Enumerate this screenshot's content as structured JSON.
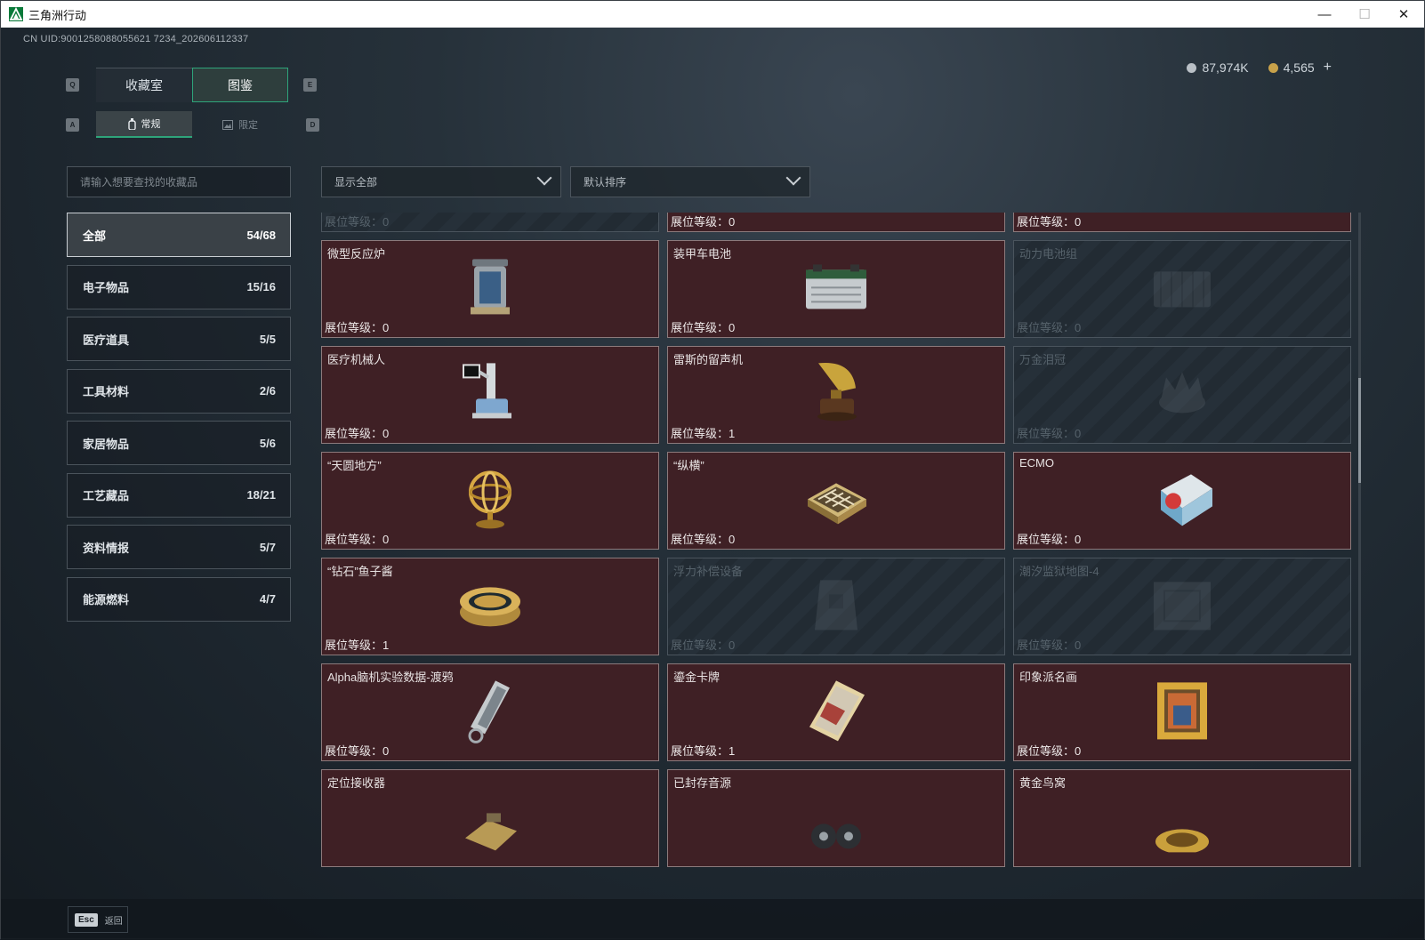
{
  "window": {
    "title": "三角洲行动",
    "minimize": "—",
    "maximize": "☐",
    "close": "✕"
  },
  "uid": "CN UID:9001258088055621 7234_202606112337",
  "currency": [
    {
      "amount": "87,974K",
      "icon": "silver-coin-icon",
      "color": "#b9c0c6"
    },
    {
      "amount": "4,565",
      "icon": "gold-coin-icon",
      "color": "#c8a24a"
    }
  ],
  "plus": "+",
  "key_hints": {
    "q": "Q",
    "e": "E",
    "a": "A",
    "d": "D"
  },
  "tabs": [
    {
      "label": "收藏室",
      "active": false
    },
    {
      "label": "图鉴",
      "active": true
    }
  ],
  "subtabs": [
    {
      "label": "常规",
      "icon": "bottle-icon",
      "active": true
    },
    {
      "label": "限定",
      "icon": "image-icon",
      "active": false
    }
  ],
  "search": {
    "placeholder": "请输入想要查找的收藏品"
  },
  "filters": {
    "show": "显示全部",
    "sort": "默认排序"
  },
  "categories": [
    {
      "label": "全部",
      "count": "54/68",
      "active": true
    },
    {
      "label": "电子物品",
      "count": "15/16"
    },
    {
      "label": "医疗道具",
      "count": "5/5"
    },
    {
      "label": "工具材料",
      "count": "2/6"
    },
    {
      "label": "家居物品",
      "count": "5/6"
    },
    {
      "label": "工艺藏品",
      "count": "18/21"
    },
    {
      "label": "资料情报",
      "count": "5/7"
    },
    {
      "label": "能源燃料",
      "count": "4/7"
    }
  ],
  "level_label": "展位等级：",
  "items": [
    {
      "name": "",
      "level": "0",
      "locked": true,
      "icon": "bag-icon"
    },
    {
      "name": "",
      "level": "0",
      "locked": false,
      "icon": "robot-vacuum-icon"
    },
    {
      "name": "",
      "level": "0",
      "locked": false,
      "icon": "coffee-bag-icon"
    },
    {
      "name": "微型反应炉",
      "level": "0",
      "locked": false,
      "icon": "reactor-icon"
    },
    {
      "name": "装甲车电池",
      "level": "0",
      "locked": false,
      "icon": "battery-icon"
    },
    {
      "name": "动力电池组",
      "level": "0",
      "locked": true,
      "icon": "battery-pack-icon"
    },
    {
      "name": "医疗机械人",
      "level": "0",
      "locked": false,
      "icon": "medical-robot-icon"
    },
    {
      "name": "雷斯的留声机",
      "level": "1",
      "locked": false,
      "icon": "gramophone-icon"
    },
    {
      "name": "万金泪冠",
      "level": "0",
      "locked": true,
      "icon": "crown-icon"
    },
    {
      "name": "“天圆地方”",
      "level": "0",
      "locked": false,
      "icon": "armillary-icon"
    },
    {
      "name": "“纵横”",
      "level": "0",
      "locked": false,
      "icon": "chessboard-icon"
    },
    {
      "name": "ECMO",
      "level": "0",
      "locked": false,
      "icon": "ecmo-icon"
    },
    {
      "name": "“钻石”鱼子酱",
      "level": "1",
      "locked": false,
      "icon": "caviar-icon"
    },
    {
      "name": "浮力补偿设备",
      "level": "0",
      "locked": true,
      "icon": "vest-icon"
    },
    {
      "name": "潮汐监狱地图-4",
      "level": "0",
      "locked": true,
      "icon": "map-icon"
    },
    {
      "name": "Alpha脑机实验数据-渡鸦",
      "level": "0",
      "locked": false,
      "icon": "data-canister-icon"
    },
    {
      "name": "鎏金卡牌",
      "level": "1",
      "locked": false,
      "icon": "card-icon"
    },
    {
      "name": "印象派名画",
      "level": "0",
      "locked": false,
      "icon": "painting-icon"
    },
    {
      "name": "定位接收器",
      "level": "",
      "locked": false,
      "icon": "receiver-icon"
    },
    {
      "name": "已封存音源",
      "level": "",
      "locked": false,
      "icon": "tape-reel-icon"
    },
    {
      "name": "黄金鸟窝",
      "level": "",
      "locked": false,
      "icon": "golden-nest-icon"
    }
  ],
  "bottom": {
    "esc_key": "Esc",
    "esc_label": "返回"
  }
}
